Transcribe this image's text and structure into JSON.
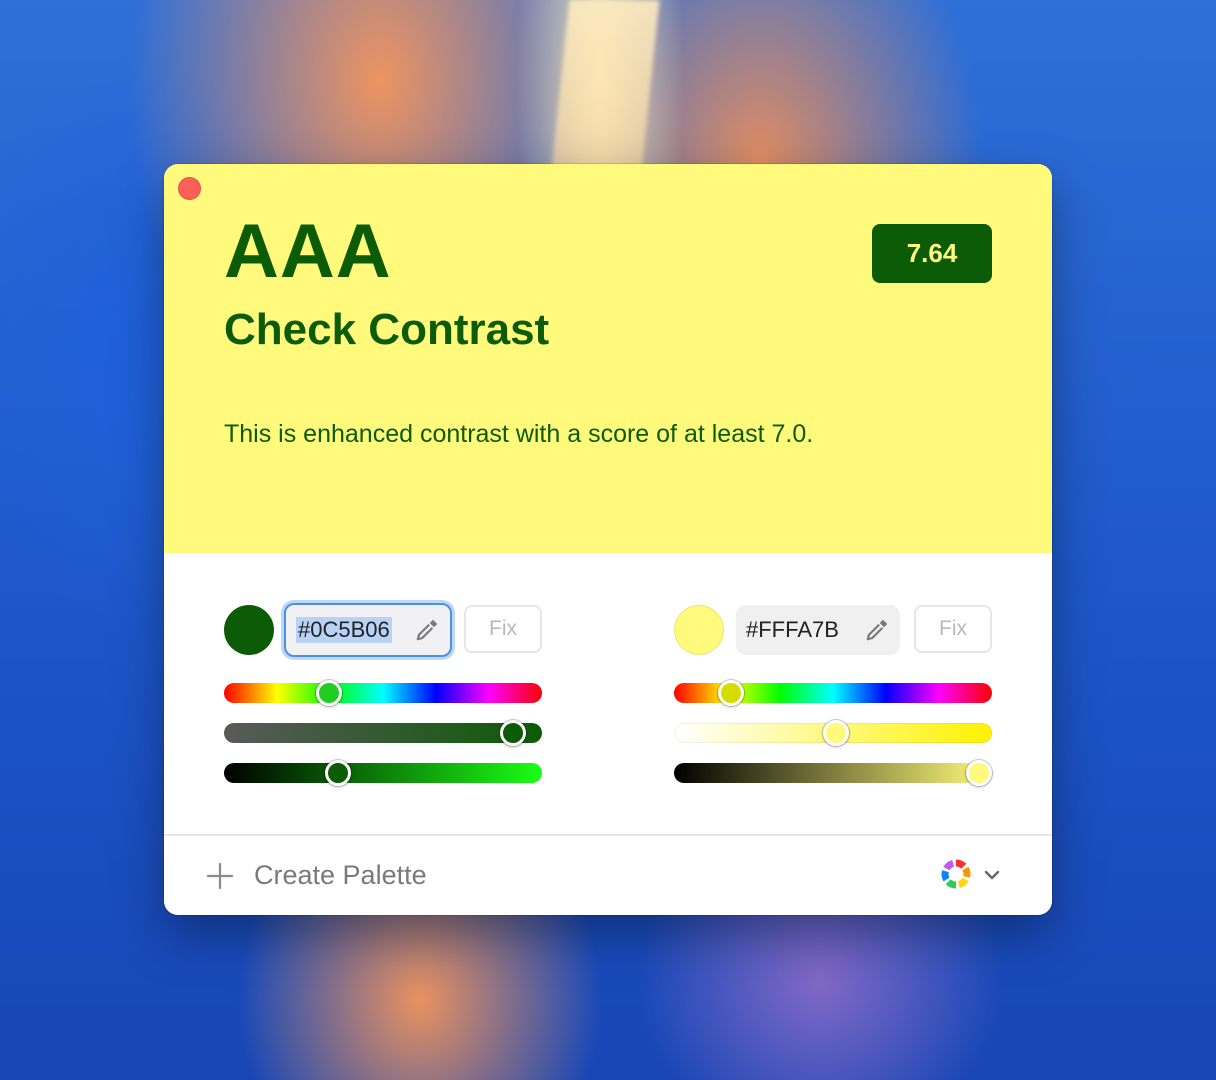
{
  "preview": {
    "level": "AAA",
    "title": "Check Contrast",
    "score": "7.64",
    "description": "This is enhanced contrast with a score of at least 7.0."
  },
  "foreground": {
    "hex": "#0C5B06",
    "fix_label": "Fix",
    "hue_level": 0.33,
    "saturation_level": 0.91,
    "brightness_level": 0.36
  },
  "background": {
    "hex": "#FFFA7B",
    "fix_label": "Fix",
    "hue_level": 0.18,
    "saturation_level": 0.51,
    "brightness_level": 0.99
  },
  "footer": {
    "create_label": "Create Palette"
  },
  "icons": {
    "close": "close-icon",
    "eyedropper": "eyedropper-icon",
    "swap": "swap-arrows-icon",
    "plus": "plus-icon",
    "palette": "color-wheel-icon",
    "chevron": "chevron-down-icon"
  },
  "colors": {
    "foreground": "#0C5B06",
    "background": "#FFFA7B",
    "close_button": "#FE5F57",
    "focus_ring": "#4A90E8"
  }
}
